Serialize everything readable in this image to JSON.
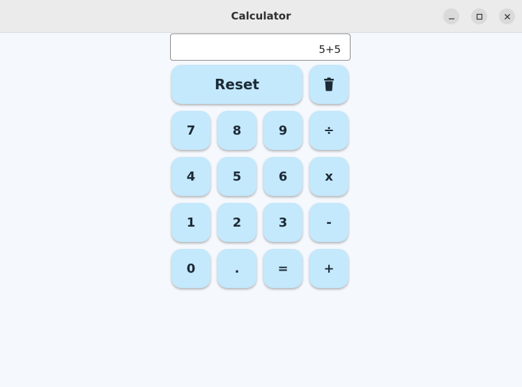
{
  "window": {
    "title": "Calculator",
    "controls": [
      "minimize-icon",
      "maximize-icon",
      "close-icon"
    ]
  },
  "display": {
    "value": "5+5"
  },
  "keys": {
    "reset": "Reset",
    "delete_icon": "trash-icon",
    "k7": "7",
    "k8": "8",
    "k9": "9",
    "divide": "÷",
    "k4": "4",
    "k5": "5",
    "k6": "6",
    "multiply": "x",
    "k1": "1",
    "k2": "2",
    "k3": "3",
    "minus": "-",
    "k0": "0",
    "dot": ".",
    "equals": "=",
    "plus": "+"
  },
  "colors": {
    "key_bg": "#c4e8fc",
    "page_bg": "#f5f8fc",
    "titlebar_bg": "#ebebeb"
  }
}
